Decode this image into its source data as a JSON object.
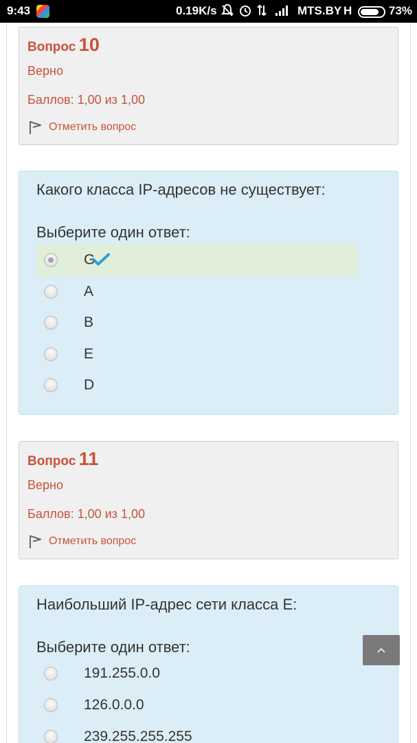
{
  "statusbar": {
    "time": "9:43",
    "speed": "0.19K/s",
    "carrier": "MTS.BY",
    "network": "H",
    "battery": "73%",
    "icons": [
      "app-icon",
      "mute-icon",
      "alarm-icon",
      "data-icon",
      "signal-icon"
    ]
  },
  "questions": [
    {
      "label": "Вопрос",
      "number": "10",
      "state": "Верно",
      "grade": "Баллов: 1,00 из 1,00",
      "flag": "Отметить вопрос",
      "text": "Какого класса IP-адресов не существует:",
      "prompt": "Выберите один ответ:",
      "options": [
        {
          "text": "G",
          "checked": true,
          "correct": true
        },
        {
          "text": "A",
          "checked": false
        },
        {
          "text": "B",
          "checked": false
        },
        {
          "text": "E",
          "checked": false
        },
        {
          "text": "D",
          "checked": false
        }
      ]
    },
    {
      "label": "Вопрос",
      "number": "11",
      "state": "Верно",
      "grade": "Баллов: 1,00 из 1,00",
      "flag": "Отметить вопрос",
      "text": "Наибольший IP-адрес сети класса E:",
      "prompt": "Выберите один ответ:",
      "options": [
        {
          "text": "191.255.0.0",
          "checked": false
        },
        {
          "text": "126.0.0.0",
          "checked": false
        },
        {
          "text": "239.255.255.255",
          "checked": false
        }
      ]
    }
  ],
  "colors": {
    "accent": "#c8523a",
    "question_bg": "#dbeef7",
    "info_bg": "#f0f0f0",
    "correct_bg": "#e1eed9",
    "check": "#2f9fd4"
  }
}
